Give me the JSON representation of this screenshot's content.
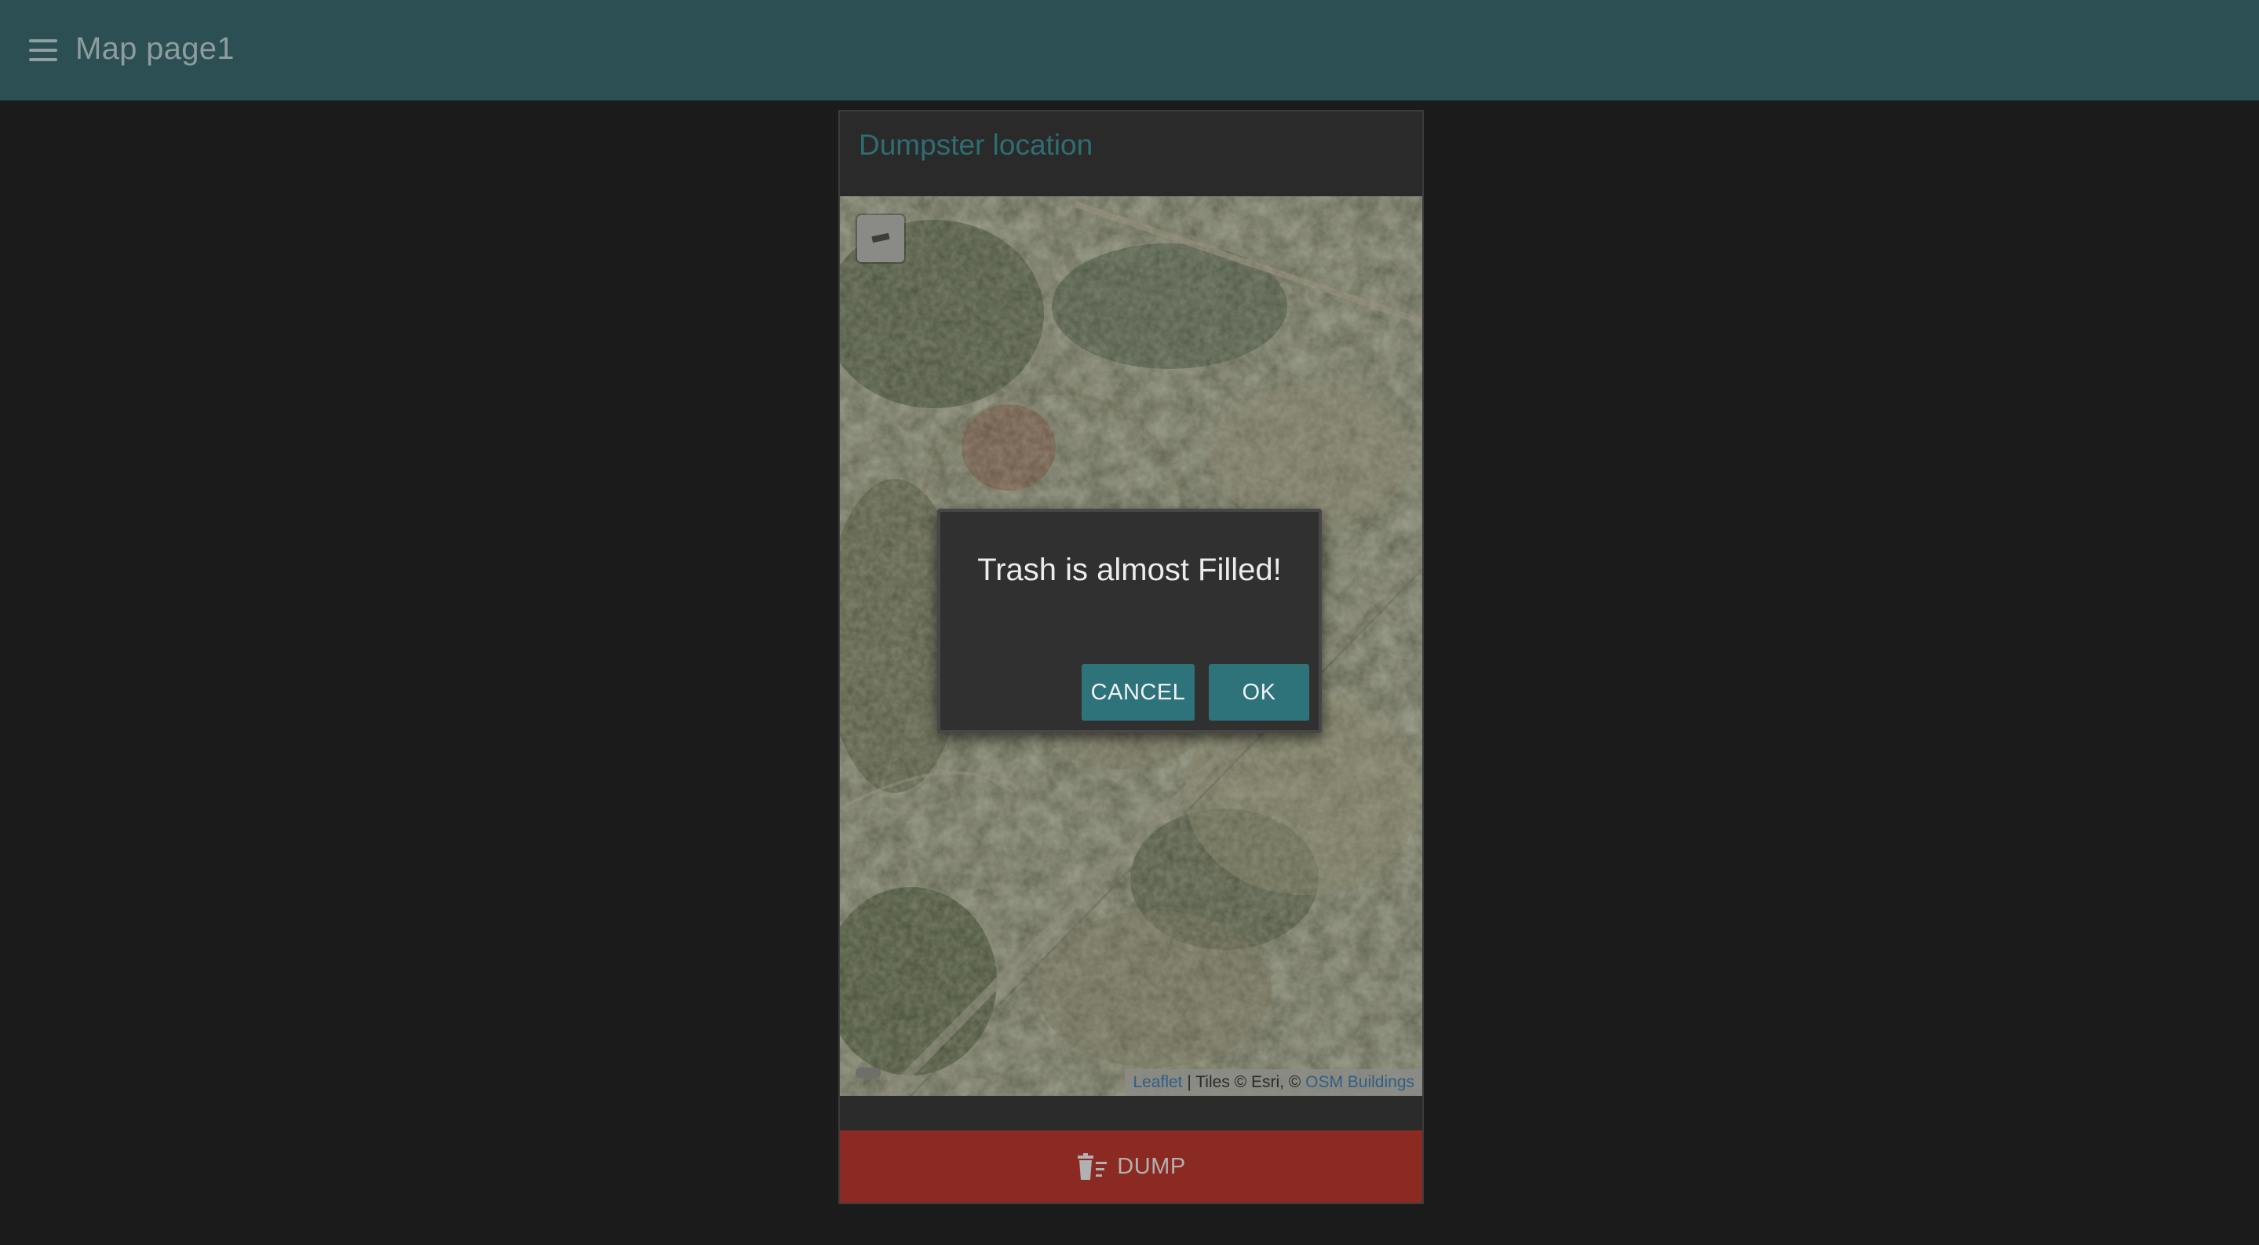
{
  "header": {
    "menu_icon": "hamburger-menu-icon",
    "title": "Map page1",
    "background": "#2c4f53"
  },
  "card": {
    "title": "Dumpster location",
    "title_color": "#2e6e73"
  },
  "map": {
    "layer_control_icon": "layers-icon",
    "attribution": {
      "leaflet_link": "Leaflet",
      "tiles_text": " | Tiles © Esri, © ",
      "osm_link": "OSM Buildings"
    }
  },
  "dump_button": {
    "label": "DUMP",
    "icon": "trash-list-icon",
    "color": "#8b2a22"
  },
  "dialog": {
    "message": "Trash is almost Filled!",
    "cancel_label": "CANCEL",
    "ok_label": "OK",
    "button_color": "#2e727a"
  }
}
